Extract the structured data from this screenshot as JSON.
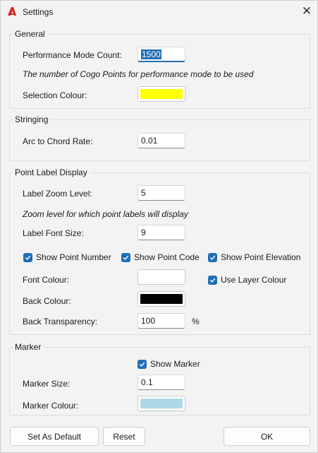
{
  "window": {
    "title": "Settings",
    "close_glyph": "✕",
    "app_icon": "autocad-a-icon"
  },
  "general": {
    "title": "General",
    "perf_label": "Performance Mode Count:",
    "perf_value": "1500",
    "perf_hint": "The number of Cogo Points for performance mode to be used",
    "sel_colour_label": "Selection Colour:",
    "sel_colour": "#ffff00"
  },
  "stringing": {
    "title": "Stringing",
    "arc_label": "Arc to Chord Rate:",
    "arc_value": "0.01"
  },
  "point_label": {
    "title": "Point Label Display",
    "zoom_label": "Label Zoom Level:",
    "zoom_value": "5",
    "zoom_hint": "Zoom level for which point labels will display",
    "font_size_label": "Label Font Size:",
    "font_size_value": "9",
    "show_number": "Show Point Number",
    "show_code": "Show Point Code",
    "show_elevation": "Show Point Elevation",
    "font_colour_label": "Font Colour:",
    "font_colour": "#ffffff",
    "use_layer": "Use Layer Colour",
    "back_colour_label": "Back Colour:",
    "back_colour": "#000000",
    "transparency_label": "Back Transparency:",
    "transparency_value": "100",
    "percent": "%"
  },
  "marker": {
    "title": "Marker",
    "show_marker": "Show Marker",
    "size_label": "Marker Size:",
    "size_value": "0.1",
    "colour_label": "Marker Colour:",
    "colour": "#add8e6"
  },
  "buttons": {
    "default": "Set As Default",
    "reset": "Reset",
    "ok": "OK"
  },
  "colors": {
    "accent": "#1f6fb5",
    "check_color": "#1f6fb5",
    "icon_red": "#d6221c"
  }
}
